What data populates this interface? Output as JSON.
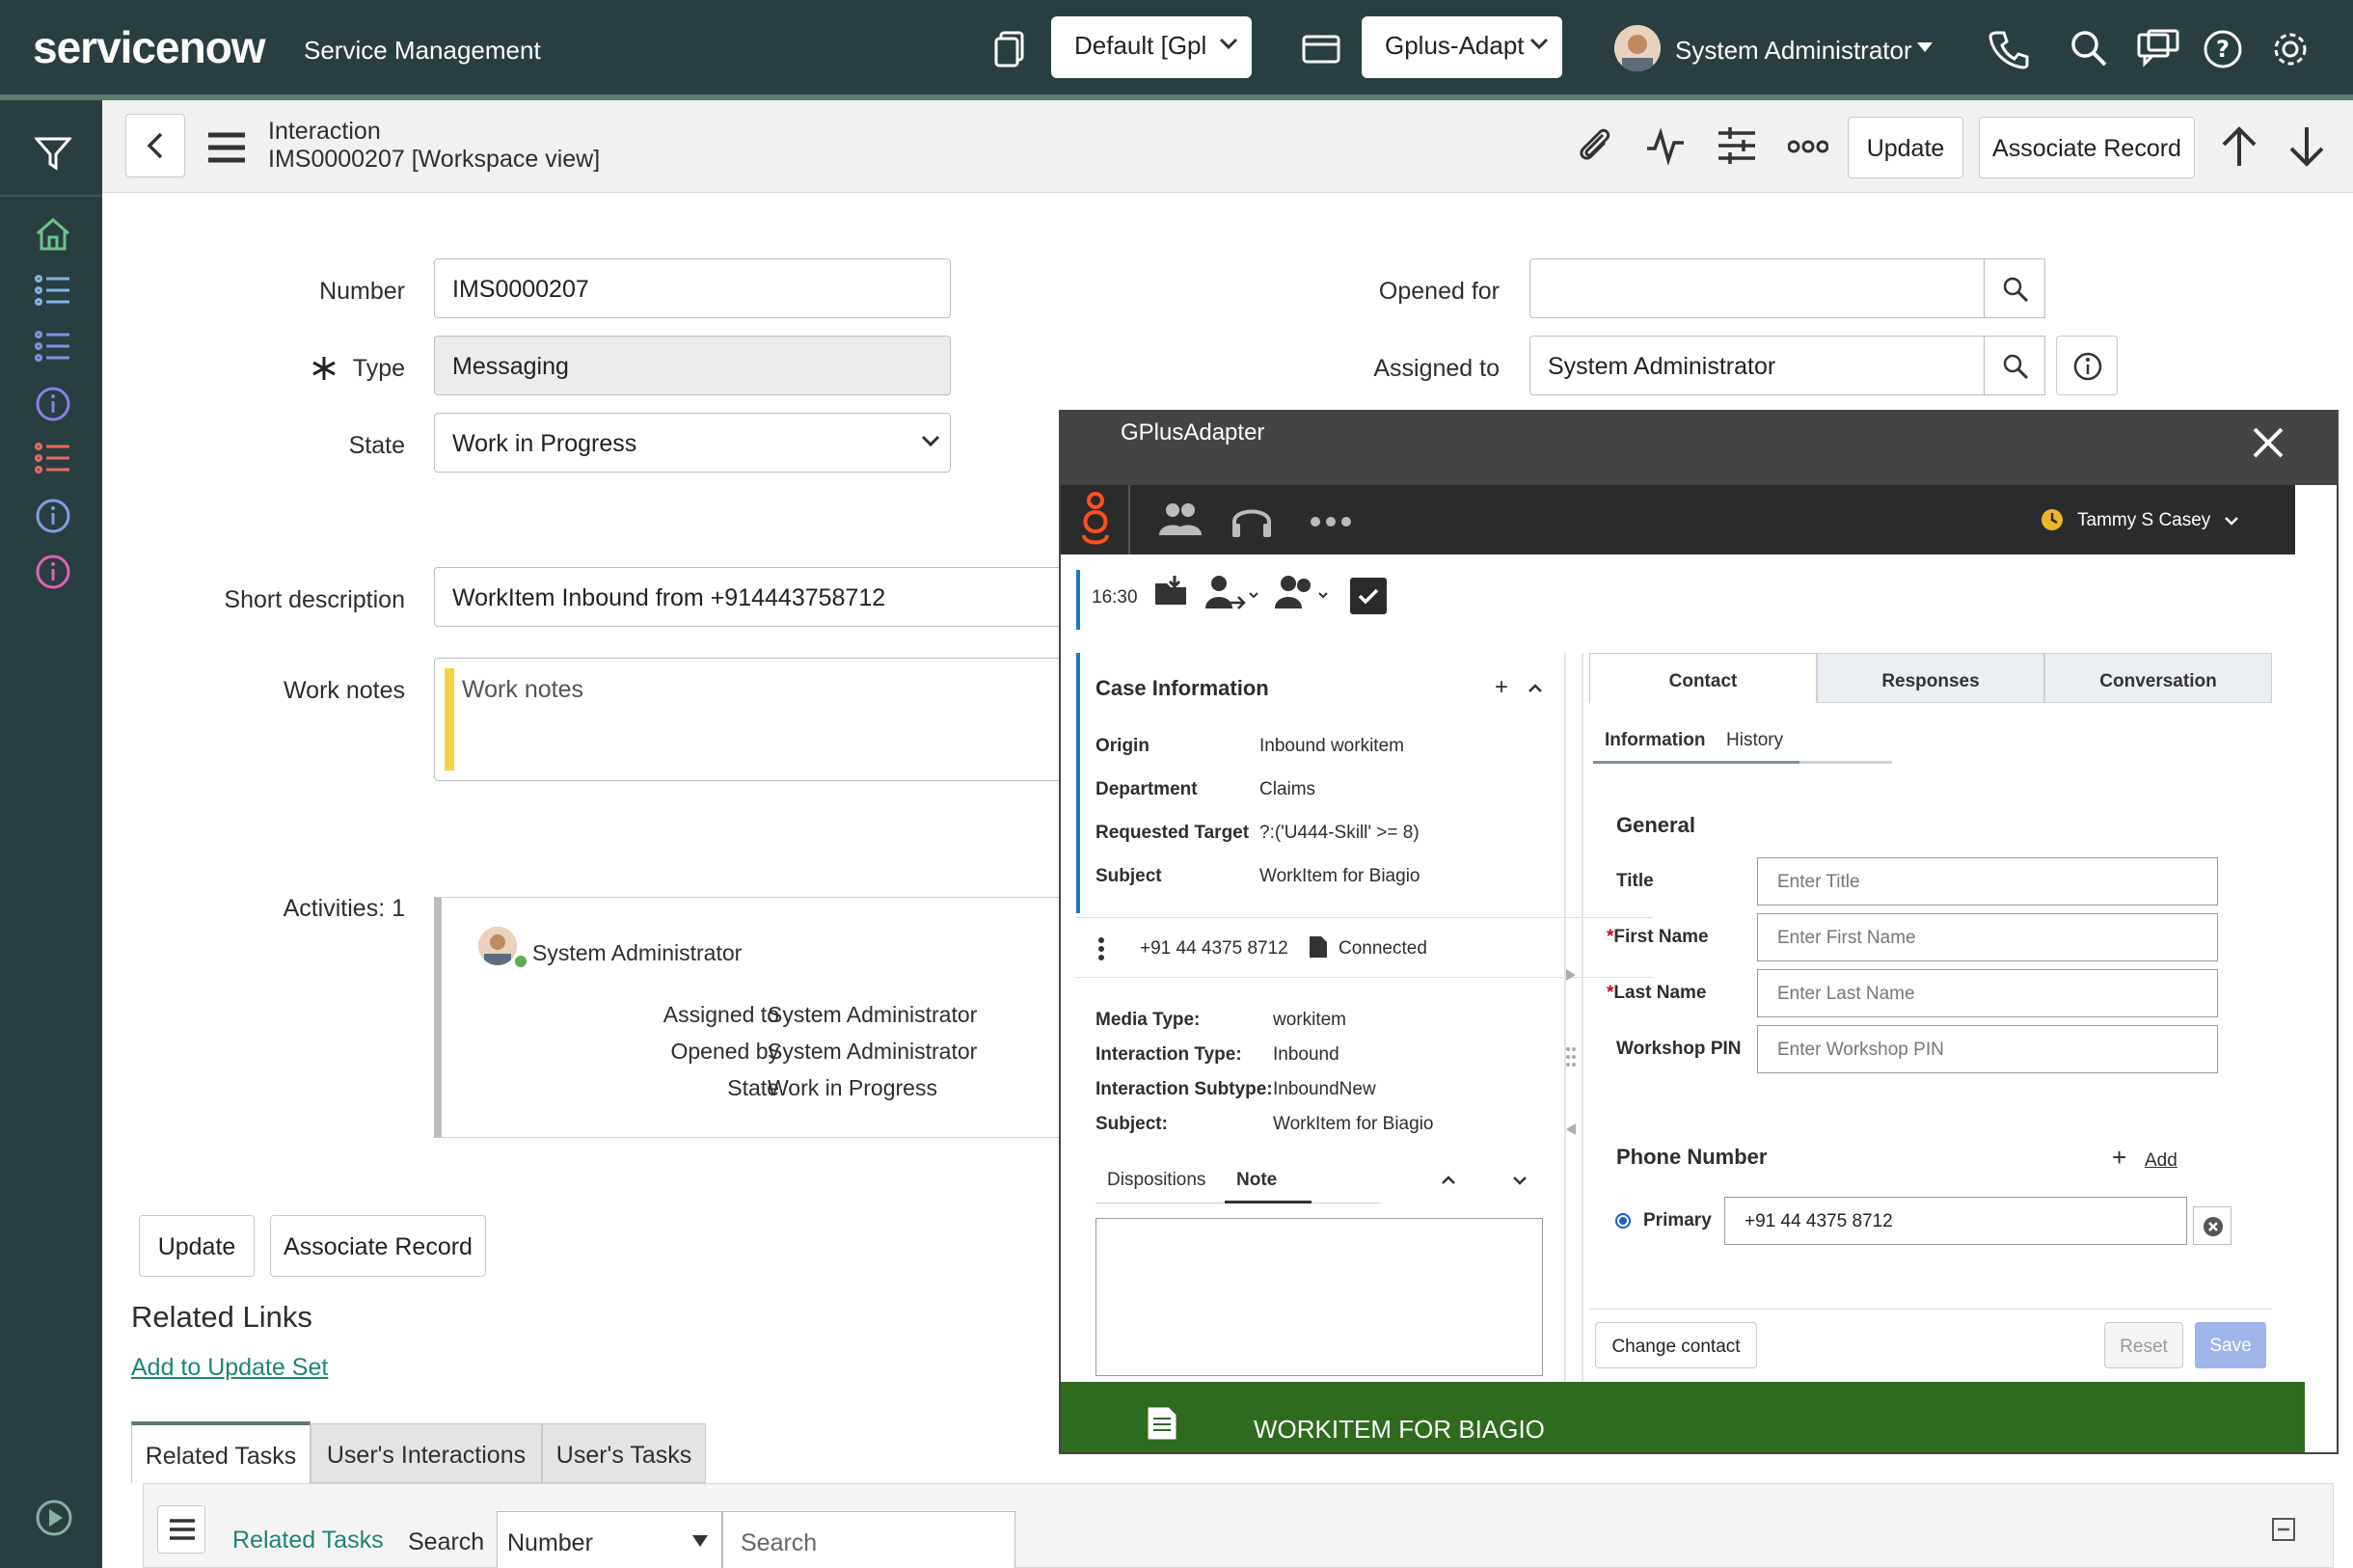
{
  "topbar": {
    "brand": "servicenow",
    "subtitle": "Service Management",
    "select1": "Default [Gpl",
    "select2": "Gplus-Adapt",
    "user": "System Administrator"
  },
  "header": {
    "title_line1": "Interaction",
    "title_line2": "IMS0000207 [Workspace view]",
    "update_label": "Update",
    "associate_label": "Associate Record"
  },
  "form": {
    "number_label": "Number",
    "number_value": "IMS0000207",
    "type_label": "Type",
    "type_value": "Messaging",
    "state_label": "State",
    "state_value": "Work in Progress",
    "opened_for_label": "Opened for",
    "opened_for_value": "",
    "assigned_to_label": "Assigned to",
    "assigned_to_value": "System Administrator",
    "short_desc_label": "Short description",
    "short_desc_value": "WorkItem Inbound from +914443758712",
    "work_notes_label": "Work notes",
    "work_notes_placeholder": "Work notes",
    "activities_label": "Activities: 1",
    "activity": {
      "user": "System Administrator",
      "rows": [
        {
          "k": "Assigned to",
          "v": "System Administrator"
        },
        {
          "k": "Opened by",
          "v": "System Administrator"
        },
        {
          "k": "State",
          "v": "Work in Progress"
        }
      ]
    },
    "update_label": "Update",
    "associate_label": "Associate Record",
    "related_links_title": "Related Links",
    "add_to_update_set": "Add to Update Set",
    "tabs": [
      "Related Tasks",
      "User's Interactions",
      "User's Tasks"
    ],
    "list_title": "Related Tasks",
    "search_label": "Search",
    "search_field": "Number",
    "search_placeholder": "Search"
  },
  "popup": {
    "title": "GPlusAdapter",
    "agent": "Tammy S Casey",
    "timer": "16:30",
    "case_title": "Case Information",
    "case": [
      {
        "k": "Origin",
        "v": "Inbound workitem"
      },
      {
        "k": "Department",
        "v": "Claims"
      },
      {
        "k": "Requested Target",
        "v": "?:('U444-Skill' >= 8)"
      },
      {
        "k": "Subject",
        "v": "WorkItem for Biagio"
      }
    ],
    "phone": "+91 44 4375 8712",
    "status": "Connected",
    "media": [
      {
        "k": "Media Type:",
        "v": "workitem"
      },
      {
        "k": "Interaction Type:",
        "v": "Inbound"
      },
      {
        "k": "Interaction Subtype:",
        "v": "InboundNew"
      },
      {
        "k": "Subject:",
        "v": "WorkItem for Biagio"
      }
    ],
    "disp_tab": "Dispositions",
    "note_tab": "Note",
    "tabs": [
      "Contact",
      "Responses",
      "Conversation"
    ],
    "subtabs": [
      "Information",
      "History"
    ],
    "general": "General",
    "fields": [
      {
        "label": "Title",
        "placeholder": "Enter Title",
        "required": false
      },
      {
        "label": "First Name",
        "placeholder": "Enter First Name",
        "required": true
      },
      {
        "label": "Last Name",
        "placeholder": "Enter Last Name",
        "required": true
      },
      {
        "label": "Workshop PIN",
        "placeholder": "Enter Workshop PIN",
        "required": false
      }
    ],
    "phone_number_title": "Phone Number",
    "add_label": "Add",
    "primary_label": "Primary",
    "primary_value": "+91 44 4375 8712",
    "change_contact": "Change contact",
    "reset": "Reset",
    "save": "Save",
    "footer": "WORKITEM FOR BIAGIO"
  }
}
